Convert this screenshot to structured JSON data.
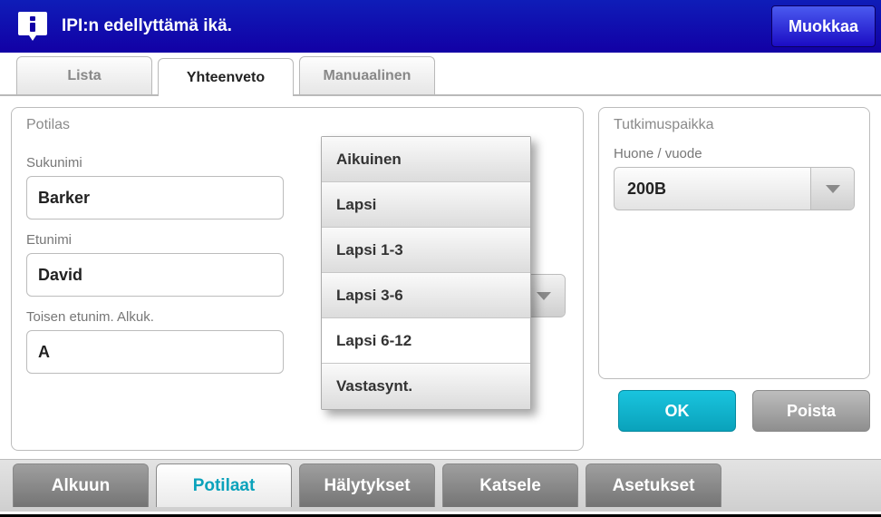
{
  "header": {
    "title": "IPI:n edellyttämä ikä.",
    "edit_label": "Muokkaa"
  },
  "tabs": [
    {
      "label": "Lista",
      "active": false
    },
    {
      "label": "Yhteenveto",
      "active": true
    },
    {
      "label": "Manuaalinen",
      "active": false
    }
  ],
  "patient_panel": {
    "title": "Potilas",
    "lastname_label": "Sukunimi",
    "lastname_value": "Barker",
    "firstname_label": "Etunimi",
    "firstname_value": "David",
    "midinit_label": "Toisen etunim. Alkuk.",
    "midinit_value": "A"
  },
  "age_dropdown": {
    "selected": "Lapsi 6-12",
    "behind_value": "Lapsi 3-6",
    "items": [
      "Aikuinen",
      "Lapsi",
      "Lapsi 1-3",
      "Lapsi 3-6",
      "Lapsi 6-12",
      "Vastasynt."
    ]
  },
  "site_panel": {
    "title": "Tutkimuspaikka",
    "room_label": "Huone / vuode",
    "room_value": "200B"
  },
  "buttons": {
    "ok": "OK",
    "delete": "Poista"
  },
  "bottom_nav": [
    {
      "label": "Alkuun",
      "active": false
    },
    {
      "label": "Potilaat",
      "active": true
    },
    {
      "label": "Hälytykset",
      "active": false
    },
    {
      "label": "Katsele",
      "active": false
    },
    {
      "label": "Asetukset",
      "active": false
    }
  ]
}
